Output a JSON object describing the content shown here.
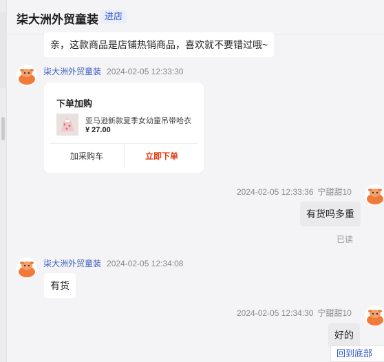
{
  "header": {
    "shop_name": "柒大洲外贸童装",
    "enter_shop_label": "进店"
  },
  "messages": {
    "m1": {
      "text": "亲，这款商品是店铺热销商品，喜欢就不要错过哦~"
    },
    "m2": {
      "nick": "柒大洲外贸童装",
      "time": "2024-02-05 12:33:30"
    },
    "order_card": {
      "title": "下单加购",
      "product_name": "亚马逊新款夏季女幼童吊带哈衣",
      "price": "¥ 27.00",
      "add_cart_label": "加采购车",
      "buy_now_label": "立即下单"
    },
    "m3": {
      "time": "2024-02-05 12:33:36",
      "nick": "宁甜甜10",
      "text": "有货吗多重",
      "status": "已读"
    },
    "m4": {
      "nick": "柒大洲外贸童装",
      "time": "2024-02-05 12:34:08",
      "text": "有货"
    },
    "m5": {
      "time": "2024-02-05 12:34:30",
      "nick": "宁甜甜10",
      "text": "好的"
    }
  },
  "back_to_bottom_label": "回到底部",
  "icons": {
    "avatar": "cartoon-animal-avatar-icon",
    "back_to_bottom": "chevron-down-icon"
  },
  "colors": {
    "accent_blue": "#2f55c8",
    "buy_red": "#e33b12",
    "avatar_orange": "#f07a3a"
  }
}
